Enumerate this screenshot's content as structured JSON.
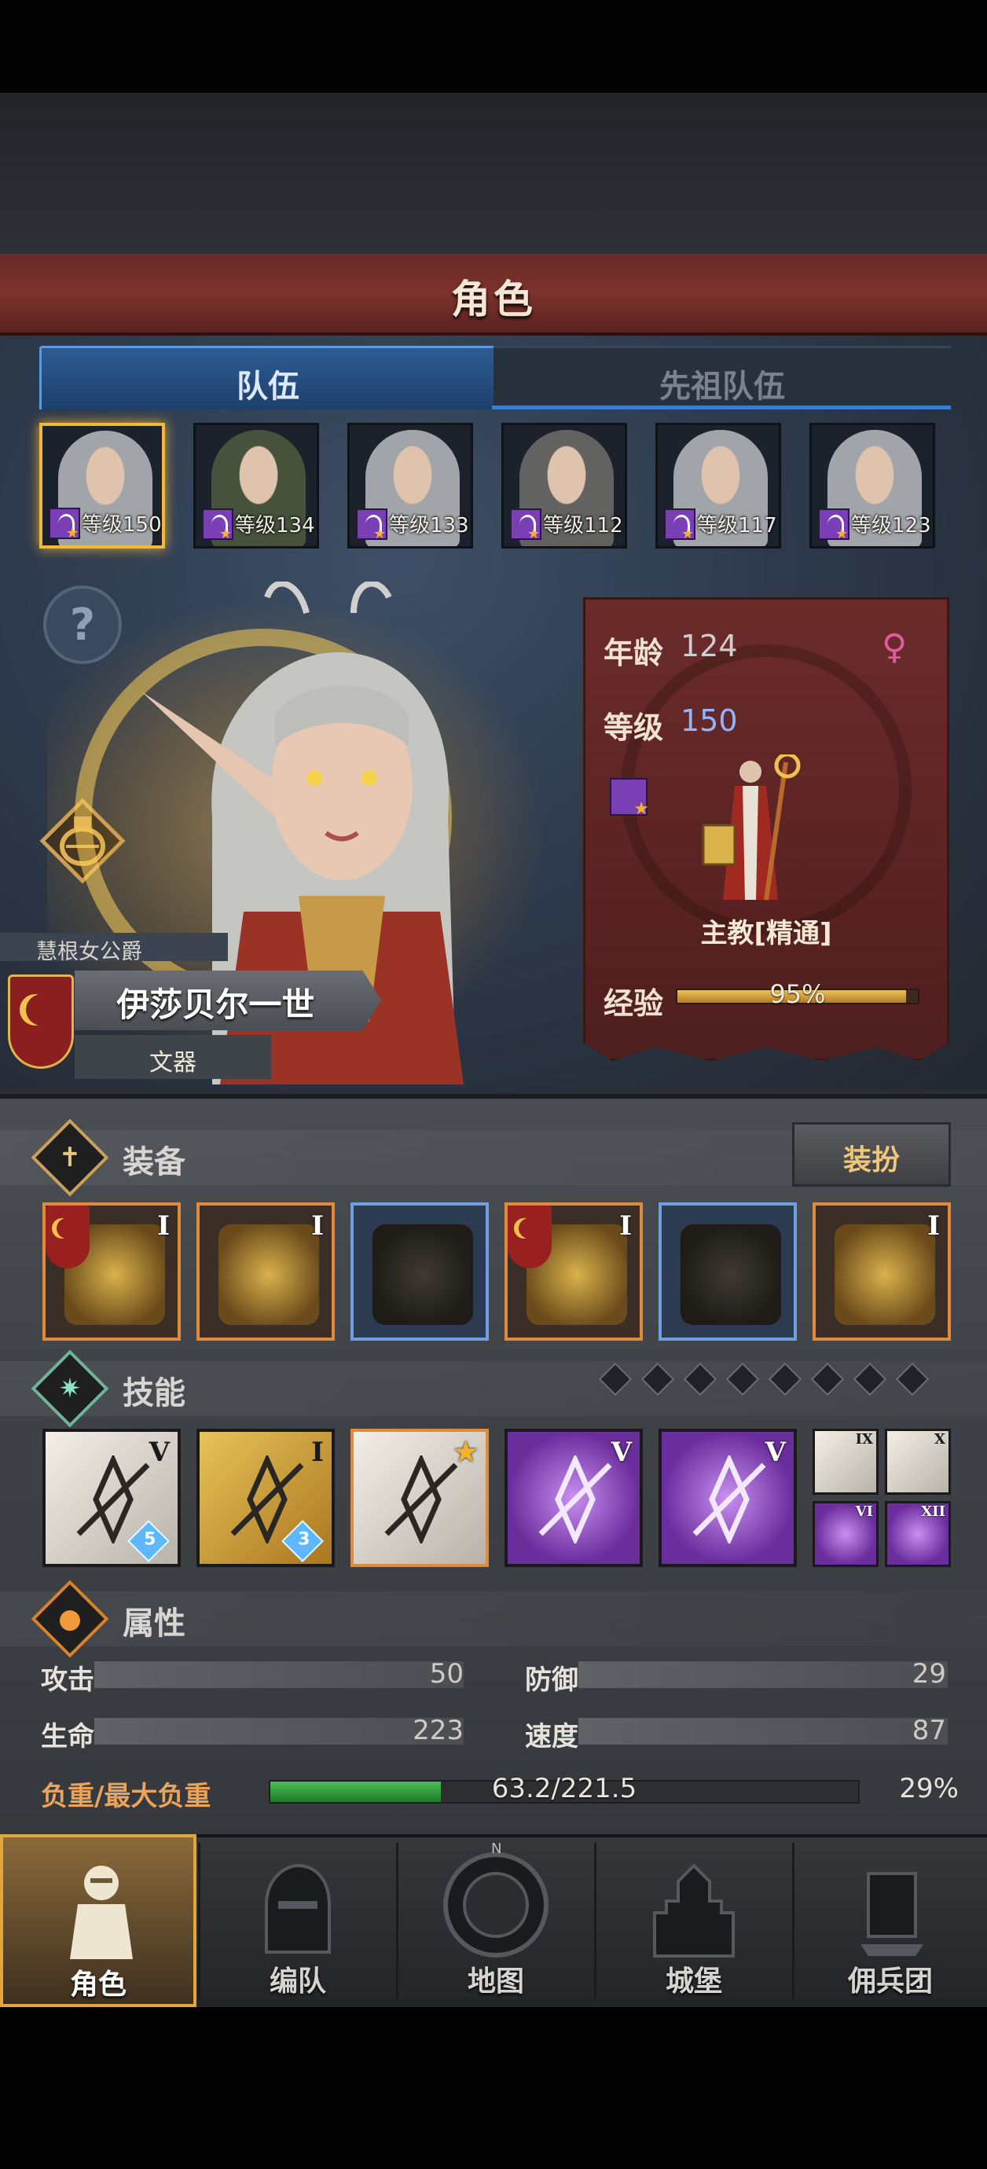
{
  "header": {
    "title": "角色"
  },
  "tabs": [
    {
      "label": "队伍",
      "active": true
    },
    {
      "label": "先祖队伍",
      "active": false
    }
  ],
  "roster": [
    {
      "level_text": "等级150",
      "hair": "silver",
      "selected": true
    },
    {
      "level_text": "等级134",
      "hair": "green",
      "selected": false
    },
    {
      "level_text": "等级133",
      "hair": "silver",
      "selected": false
    },
    {
      "level_text": "等级112",
      "hair": "dark",
      "selected": false
    },
    {
      "level_text": "等级117",
      "hair": "silver",
      "selected": false
    },
    {
      "level_text": "等级123",
      "hair": "silver",
      "selected": false
    }
  ],
  "hero": {
    "title_rank": "慧根女公爵",
    "name": "伊莎贝尔一世",
    "role": "文器",
    "help_icon": "question-icon",
    "potion_icon": "potion-icon"
  },
  "info": {
    "age_label": "年龄",
    "age_value": "124",
    "gender_icon": "female-icon",
    "level_label": "等级",
    "level_value": "150",
    "class_name": "主教[精通]",
    "exp_label": "经验",
    "exp_text": "95%",
    "exp_fraction": 0.95
  },
  "equipment": {
    "section_title": "装备",
    "outfit_button": "装扮",
    "slots": [
      {
        "frame": "orange",
        "tier": "I",
        "crest": true,
        "name": "staff-icon"
      },
      {
        "frame": "orange",
        "tier": "I",
        "crest": false,
        "name": "tome-icon"
      },
      {
        "frame": "blue",
        "tier": "",
        "crest": false,
        "name": "hood-icon"
      },
      {
        "frame": "orange",
        "tier": "I",
        "crest": true,
        "name": "armor-icon"
      },
      {
        "frame": "blue",
        "tier": "",
        "crest": false,
        "name": "boots-icon"
      },
      {
        "frame": "orange",
        "tier": "I",
        "crest": false,
        "name": "crystal-icon"
      }
    ]
  },
  "skills": {
    "section_title": "技能",
    "pips": 8,
    "items": [
      {
        "style": "white",
        "tier": "V",
        "gem": "5",
        "name": "spear-altar-skill-icon"
      },
      {
        "style": "gold",
        "tier": "I",
        "gem": "3",
        "name": "shield-cross-skill-icon"
      },
      {
        "style": "whiteo",
        "tier": "★",
        "gem": "",
        "name": "crystal-altar-skill-icon"
      },
      {
        "style": "purple",
        "tier": "V",
        "gem": "",
        "name": "crystal-arm-skill-icon"
      },
      {
        "style": "purple",
        "tier": "V",
        "gem": "",
        "name": "holy-spear-skill-icon"
      }
    ],
    "mini": [
      {
        "style": "white",
        "tier": "IX"
      },
      {
        "style": "white",
        "tier": "X"
      },
      {
        "style": "purple",
        "tier": "VI"
      },
      {
        "style": "purple",
        "tier": "XII"
      }
    ]
  },
  "attributes": {
    "section_title": "属性",
    "attack_label": "攻击",
    "attack_value": "50",
    "defense_label": "防御",
    "defense_value": "29",
    "hp_label": "生命",
    "hp_value": "223",
    "speed_label": "速度",
    "speed_value": "87",
    "weight_label": "负重/最大负重",
    "weight_text": "63.2/221.5",
    "weight_pct": "29%",
    "weight_fraction": 0.29
  },
  "nav": [
    {
      "label": "角色",
      "active": true
    },
    {
      "label": "编队",
      "active": false
    },
    {
      "label": "地图",
      "active": false
    },
    {
      "label": "城堡",
      "active": false
    },
    {
      "label": "佣兵团",
      "active": false
    }
  ],
  "colors": {
    "accent_gold": "#f0b93c",
    "header_red": "#7d322d",
    "tab_blue": "#2c5c95",
    "exp_gold": "#f0c35a",
    "weight_green": "#4bbd52"
  }
}
